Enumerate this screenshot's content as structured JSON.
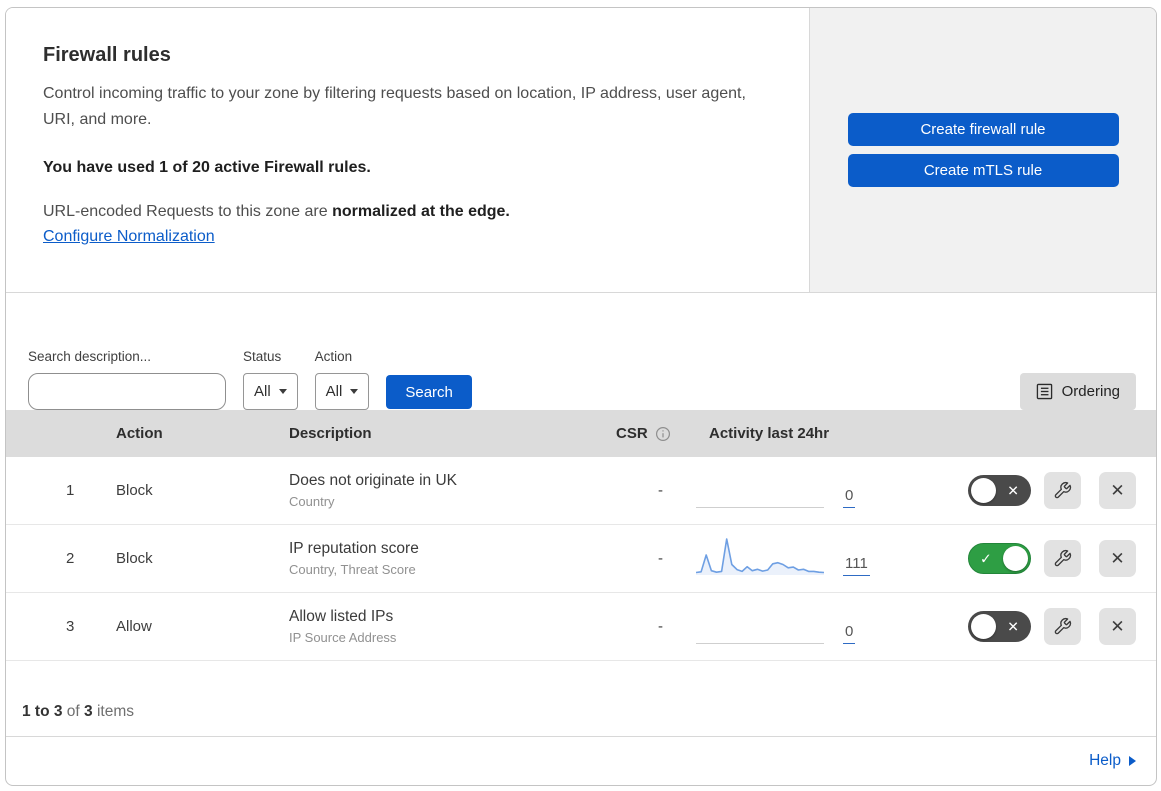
{
  "header": {
    "title": "Firewall rules",
    "description": "Control incoming traffic to your zone by filtering requests based on location, IP address, user agent, URI, and more.",
    "usage_notice": "You have used 1 of 20 active Firewall rules.",
    "normalization_prefix": "URL-encoded Requests to this zone are ",
    "normalization_bold": "normalized at the edge.",
    "normalization_link": "Configure Normalization",
    "create_firewall_button": "Create firewall rule",
    "create_mtls_button": "Create mTLS rule"
  },
  "filters": {
    "search_label": "Search description...",
    "status_label": "Status",
    "status_value": "All",
    "action_label": "Action",
    "action_value": "All",
    "search_button": "Search",
    "ordering_button": "Ordering"
  },
  "table": {
    "columns": {
      "action": "Action",
      "description": "Description",
      "csr": "CSR",
      "activity": "Activity last 24hr"
    },
    "rows": [
      {
        "index": "1",
        "action": "Block",
        "description": "Does not originate in UK",
        "criteria": "Country",
        "csr": "-",
        "activity_count": "0",
        "enabled": false
      },
      {
        "index": "2",
        "action": "Block",
        "description": "IP reputation score",
        "criteria": "Country, Threat Score",
        "csr": "-",
        "activity_count": "111",
        "enabled": true,
        "sparkline": [
          4,
          6,
          52,
          9,
          5,
          7,
          96,
          26,
          12,
          7,
          20,
          9,
          13,
          8,
          11,
          28,
          31,
          26,
          17,
          19,
          11,
          13,
          7,
          7,
          5,
          4
        ]
      },
      {
        "index": "3",
        "action": "Allow",
        "description": "Allow listed IPs",
        "criteria": "IP Source Address",
        "csr": "-",
        "activity_count": "0",
        "enabled": false
      }
    ]
  },
  "footer": {
    "range_text": "1 to 3",
    "of_text": " of ",
    "total_text": "3",
    "items_text": " items",
    "help_label": "Help"
  },
  "colors": {
    "accent_blue": "#0b5cc9",
    "toggle_on_green": "#2e9e44",
    "toggle_off_gray": "#4a4a4a",
    "sparkline_blue": "#6e9fe3",
    "table_header_gray": "#dcdcdc",
    "panel_gray": "#f1f1f1"
  }
}
